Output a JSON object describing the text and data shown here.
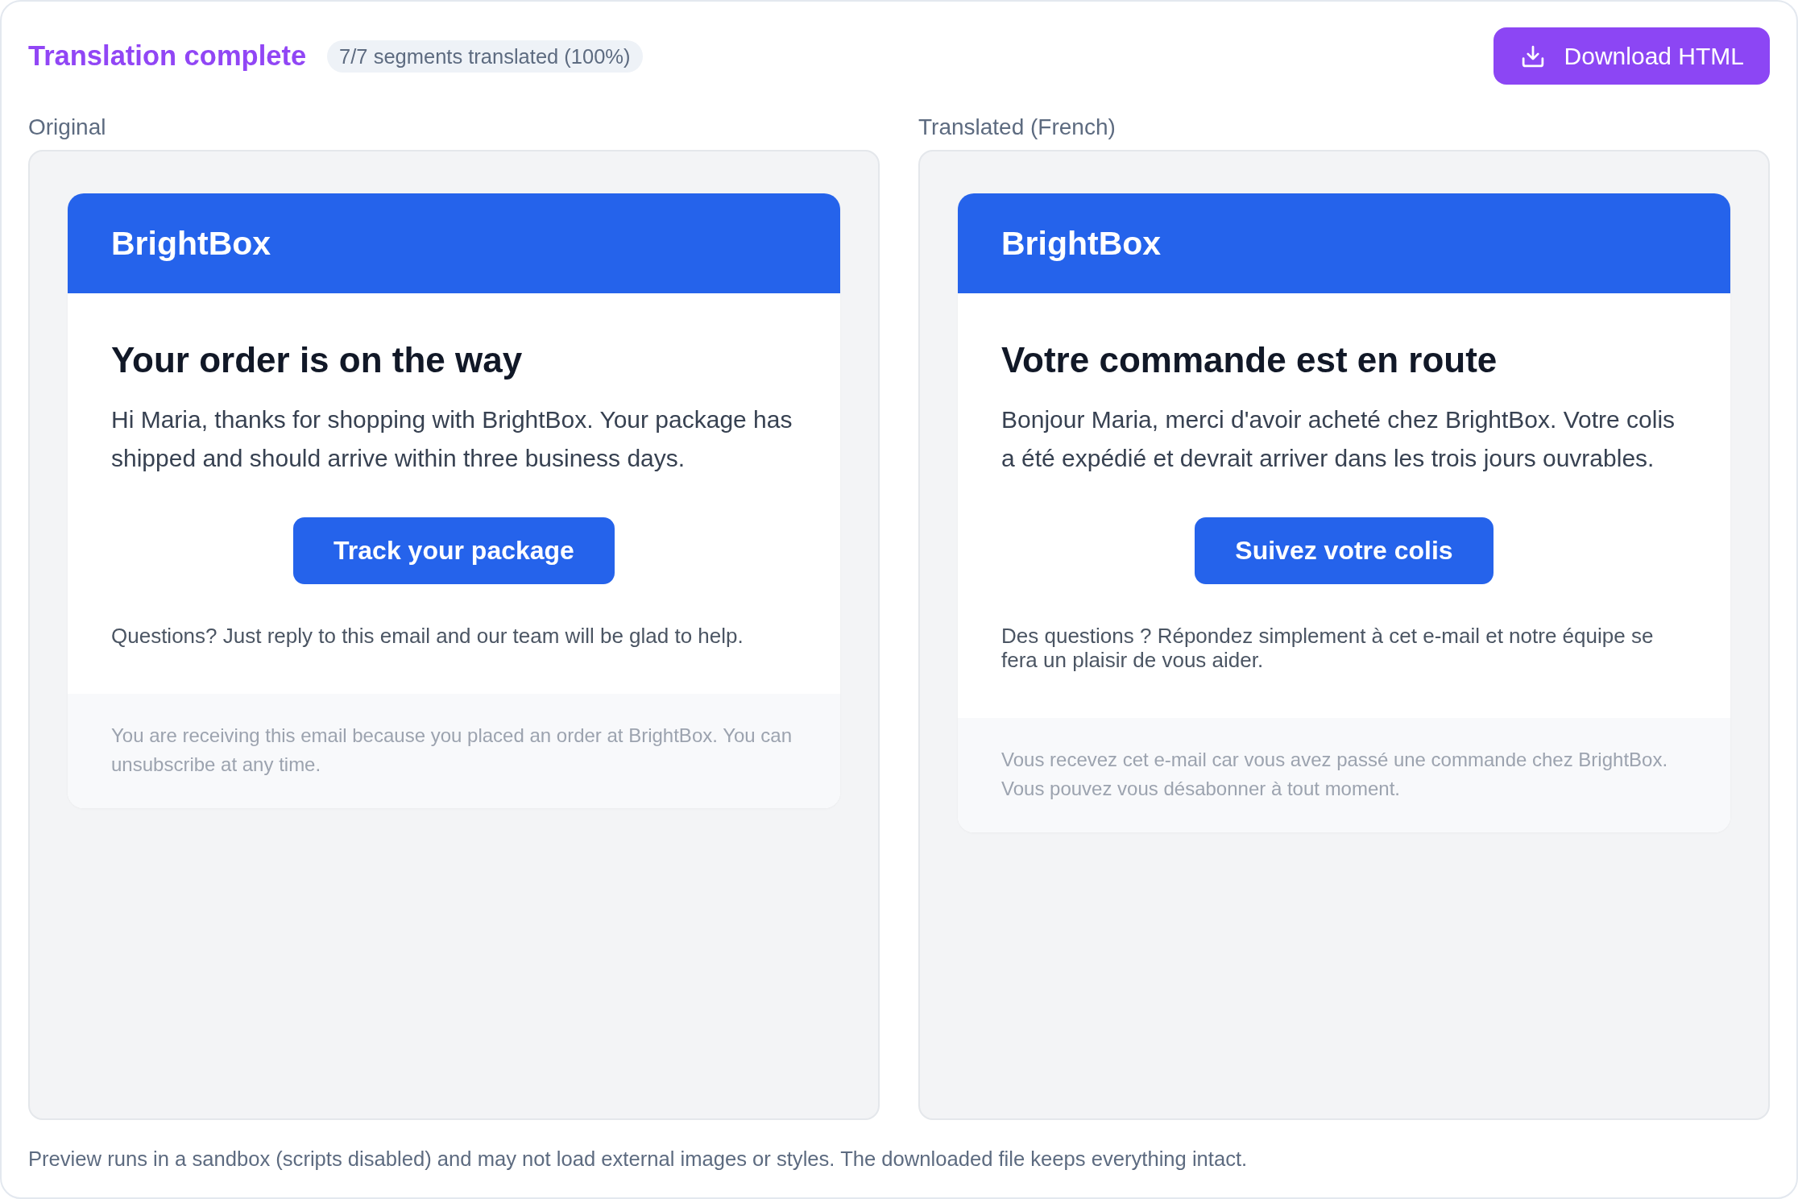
{
  "header": {
    "title": "Translation complete",
    "badge": "7/7 segments translated (100%)",
    "download_button": "Download HTML"
  },
  "panes": [
    {
      "label": "Original",
      "email": {
        "brand": "BrightBox",
        "heading": "Your order is on the way",
        "body": "Hi Maria, thanks for shopping with BrightBox. Your package has shipped and should arrive within three business days.",
        "button": "Track your package",
        "help": "Questions? Just reply to this email and our team will be glad to help.",
        "footer": "You are receiving this email because you placed an order at BrightBox. You can unsubscribe at any time."
      }
    },
    {
      "label": "Translated (French)",
      "email": {
        "brand": "BrightBox",
        "heading": "Votre commande est en route",
        "body": "Bonjour Maria, merci d'avoir acheté chez BrightBox. Votre colis a été expédié et devrait arriver dans les trois jours ouvrables.",
        "button": "Suivez votre colis",
        "help": "Des questions ? Répondez simplement à cet e-mail et notre équipe se fera un plaisir de vous aider.",
        "footer": "Vous recevez cet e-mail car vous avez passé une commande chez BrightBox. Vous pouvez vous désabonner à tout moment."
      }
    }
  ],
  "notice": "Preview runs in a sandbox (scripts disabled) and may not load external images or styles. The downloaded file keeps everything intact."
}
